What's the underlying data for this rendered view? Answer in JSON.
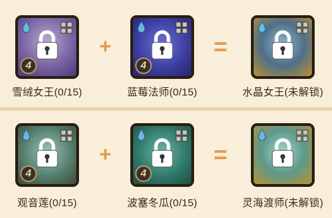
{
  "recipes": [
    {
      "ingredient_a": {
        "name": "雪绒女王(0/15)",
        "rank": "4",
        "art": "snow-queen"
      },
      "ingredient_b": {
        "name": "蓝莓法师(0/15)",
        "rank": "4",
        "art": "blueberry-mage"
      },
      "result": {
        "name": "水晶女王(未解锁)",
        "art": "crystal-queen"
      },
      "plus": "+",
      "equals": "="
    },
    {
      "ingredient_a": {
        "name": "观音莲(0/15)",
        "rank": "4",
        "art": "lotus"
      },
      "ingredient_b": {
        "name": "波塞冬瓜(0/15)",
        "rank": "4",
        "art": "poseidon-melon"
      },
      "result": {
        "name": "灵海渡师(未解锁)",
        "art": "spirit-sea-ferryman"
      },
      "plus": "+",
      "equals": "="
    }
  ],
  "colors": {
    "background": "#f8eed9",
    "operator": "#e39b4a",
    "label_text": "#3a2a1c",
    "card_border": "#2a1d12"
  },
  "icons": [
    "lock-icon",
    "grid-icon",
    "water-drop-icon",
    "rank-badge"
  ]
}
